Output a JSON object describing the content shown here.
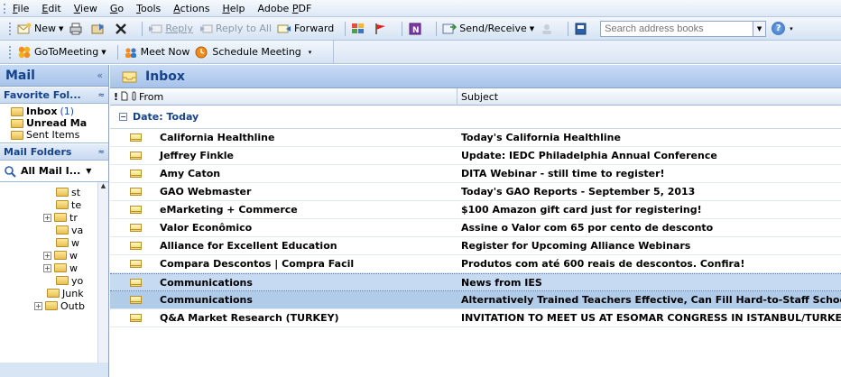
{
  "menu": {
    "items": [
      {
        "pre": "",
        "u": "F",
        "post": "ile"
      },
      {
        "pre": "",
        "u": "E",
        "post": "dit"
      },
      {
        "pre": "",
        "u": "V",
        "post": "iew"
      },
      {
        "pre": "",
        "u": "G",
        "post": "o"
      },
      {
        "pre": "",
        "u": "T",
        "post": "ools"
      },
      {
        "pre": "",
        "u": "A",
        "post": "ctions"
      },
      {
        "pre": "",
        "u": "H",
        "post": "elp"
      },
      {
        "pre": "Adobe ",
        "u": "P",
        "post": "DF"
      }
    ]
  },
  "toolbar1": {
    "new_label": "New",
    "reply_label": "Reply",
    "reply_all_label": "Reply to All",
    "forward_label": "Forward",
    "send_receive_label": "Send/Receive",
    "search_placeholder": "Search address books"
  },
  "toolbar2": {
    "gotomeeting_label": "GoToMeeting",
    "meet_now_label": "Meet Now",
    "schedule_label": "Schedule Meeting"
  },
  "nav": {
    "title": "Mail",
    "collapse_glyph": "«",
    "favorites_header": "Favorite Fol...",
    "favorites": [
      {
        "label": "Inbox",
        "count": "(1)",
        "bold": true
      },
      {
        "label": "Unread Ma",
        "count": "",
        "bold": true
      },
      {
        "label": "Sent Items",
        "count": "",
        "bold": false
      }
    ],
    "mail_folders_header": "Mail Folders",
    "all_mail_label": "All Mail I...",
    "tree": [
      {
        "label": "st",
        "plus": false,
        "indent": 62
      },
      {
        "label": "te",
        "plus": false,
        "indent": 62
      },
      {
        "label": "tr",
        "plus": true,
        "indent": 48
      },
      {
        "label": "va",
        "plus": false,
        "indent": 62
      },
      {
        "label": "w",
        "plus": false,
        "indent": 62
      },
      {
        "label": "w",
        "plus": true,
        "indent": 48
      },
      {
        "label": "w",
        "plus": true,
        "indent": 48
      },
      {
        "label": "yo",
        "plus": false,
        "indent": 62
      },
      {
        "label": "Junk",
        "plus": false,
        "indent": 52
      },
      {
        "label": "Outb",
        "plus": true,
        "indent": 38
      }
    ]
  },
  "inbox": {
    "title": "Inbox",
    "col_from": "From",
    "col_subject": "Subject",
    "col_flags": "!",
    "group_label": "Date: Today",
    "messages": [
      {
        "from": "California Healthline",
        "subject": "Today's California Healthline"
      },
      {
        "from": "Jeffrey Finkle",
        "subject": "Update: IEDC Philadelphia Annual Conference"
      },
      {
        "from": "Amy Caton",
        "subject": "DITA  Webinar - still time to register!"
      },
      {
        "from": "GAO Webmaster",
        "subject": "Today's GAO Reports - September 5, 2013"
      },
      {
        "from": "eMarketing + Commerce",
        "subject": "$100 Amazon gift card just for registering!"
      },
      {
        "from": "Valor Econômico",
        "subject": "Assine o Valor com 65 por cento de desconto"
      },
      {
        "from": "Alliance for Excellent Education",
        "subject": "Register for Upcoming Alliance Webinars"
      },
      {
        "from": "Compara Descontos | Compra Facil",
        "subject": "Produtos com até 600 reais de descontos. Confira!"
      },
      {
        "from": "Communications",
        "subject": "News from IES"
      },
      {
        "from": "Communications",
        "subject": "Alternatively Trained Teachers Effective, Can Fill Hard-to-Staff Schools"
      },
      {
        "from": "Q&A Market Research (TURKEY)",
        "subject": "INVITATION TO MEET US AT ESOMAR CONGRESS IN ISTANBUL/TURKEY"
      }
    ]
  },
  "colors": {
    "header_text": "#15428b",
    "selection": "#c6daf2"
  }
}
